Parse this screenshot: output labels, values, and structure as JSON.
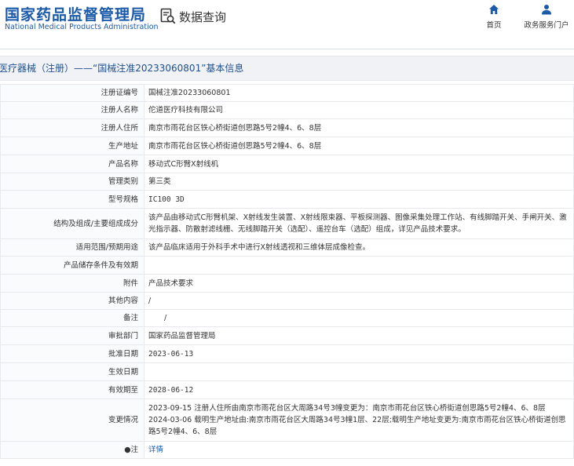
{
  "header": {
    "logo_cn": "国家药品监督管理局",
    "logo_en": "National Medical Products Administration",
    "query_title": "数据查询",
    "nav": [
      {
        "label": "首页",
        "icon": "home-icon"
      },
      {
        "label": "政务服务门户",
        "icon": "user-icon"
      }
    ],
    "brand_color": "#1a5aa8"
  },
  "title": "医疗器械（注册）——“国械注准20233060801”基本信息",
  "rows": [
    {
      "label": "注册证编号",
      "value": "国械注准20233060801"
    },
    {
      "label": "注册人名称",
      "value": "佗道医疗科技有限公司"
    },
    {
      "label": "注册人住所",
      "value": "南京市雨花台区铁心桥街道创思路5号2幢4、6、8层"
    },
    {
      "label": "生产地址",
      "value": "南京市雨花台区铁心桥街道创思路5号2幢4、6、8层"
    },
    {
      "label": "产品名称",
      "value": "移动式C形臂X射线机"
    },
    {
      "label": "管理类别",
      "value": "第三类"
    },
    {
      "label": "型号规格",
      "value": "IC100 3D"
    },
    {
      "label": "结构及组成/主要组成成分",
      "value": "该产品由移动式C形臂机架、X射线发生装置、X射线限束器、平板探测器、图像采集处理工作站、有线脚踏开关、手闸开关、激光指示器、防散射滤线栅、无线脚踏开关（选配）、遥控台车（选配）组成，详见产品技术要求。"
    },
    {
      "label": "适用范围/预期用途",
      "value": "该产品临床适用于外科手术中进行X射线透视和三维体层成像检查。"
    },
    {
      "label": "产品储存条件及有效期",
      "value": ""
    },
    {
      "label": "附件",
      "value": "产品技术要求"
    },
    {
      "label": "其他内容",
      "value": "/"
    },
    {
      "label": "备注",
      "value": "/"
    },
    {
      "label": "审批部门",
      "value": "国家药品监督管理局"
    },
    {
      "label": "批准日期",
      "value": "2023-06-13"
    },
    {
      "label": "生效日期",
      "value": ""
    },
    {
      "label": "有效期至",
      "value": "2028-06-12"
    },
    {
      "label": "变更情况",
      "value_lines": [
        "2023-09-15 注册人住所由南京市雨花台区大周路34号3幢变更为：南京市雨花台区铁心桥街道创思路5号2幢4、6、8层",
        "2024-03-06 载明生产地址由:南京市雨花台区大周路34号3幢1层、22层;载明生产地址变更为:南京市雨花台区铁心桥街道创思路5号2幢4、6、8层"
      ]
    },
    {
      "label": "●注",
      "value": "详情"
    }
  ]
}
